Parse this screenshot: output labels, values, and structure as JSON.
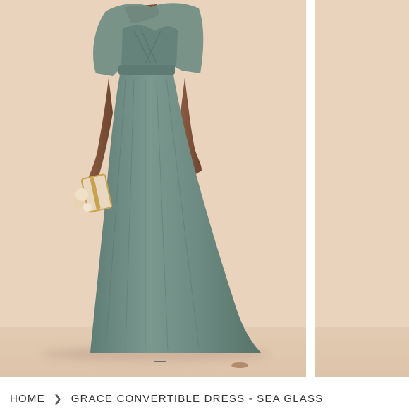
{
  "product": {
    "image_alt": "Grace Convertible Dress in Sea Glass",
    "color_hex": "#6b8a81",
    "backdrop_hex": "#e9d3bd"
  },
  "breadcrumb": {
    "home_label": "HOME",
    "separator_icon": "chevron-right-icon",
    "current_label": "GRACE CONVERTIBLE DRESS - SEA GLASS"
  }
}
